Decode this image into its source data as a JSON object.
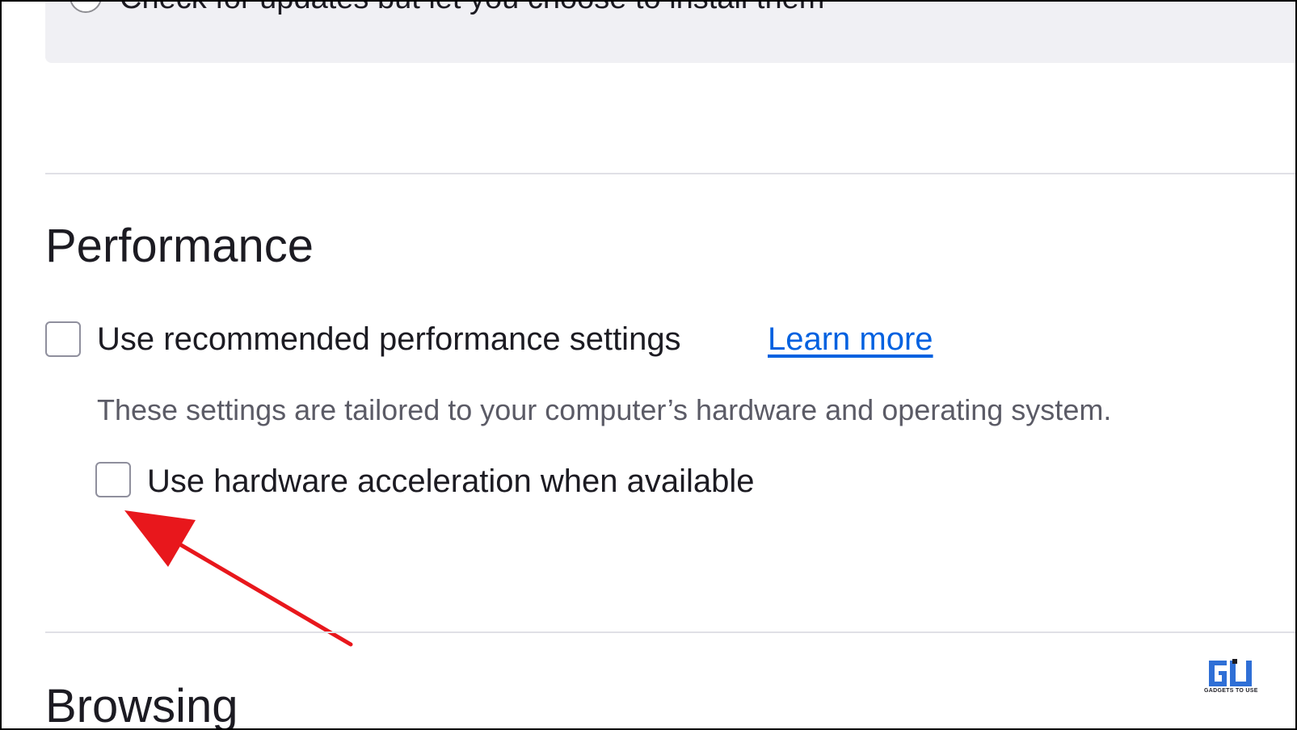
{
  "updates": {
    "option_label": "Check for updates but let you choose to install them"
  },
  "performance": {
    "title": "Performance",
    "recommended_label": "Use recommended performance settings",
    "learn_more": "Learn more",
    "description": "These settings are tailored to your computer’s hardware and operating system.",
    "hw_accel_label": "Use hardware acceleration when available",
    "recommended_checked": false,
    "hw_accel_checked": false
  },
  "browsing": {
    "title": "Browsing"
  },
  "watermark": {
    "logo_text": "GADGETS TO USE"
  },
  "colors": {
    "link": "#0061e0",
    "arrow": "#e8171c",
    "logo": "#2f6fd6"
  },
  "icons": {
    "annotation": "red-arrow-icon",
    "logo": "gadgets-to-use-logo"
  }
}
